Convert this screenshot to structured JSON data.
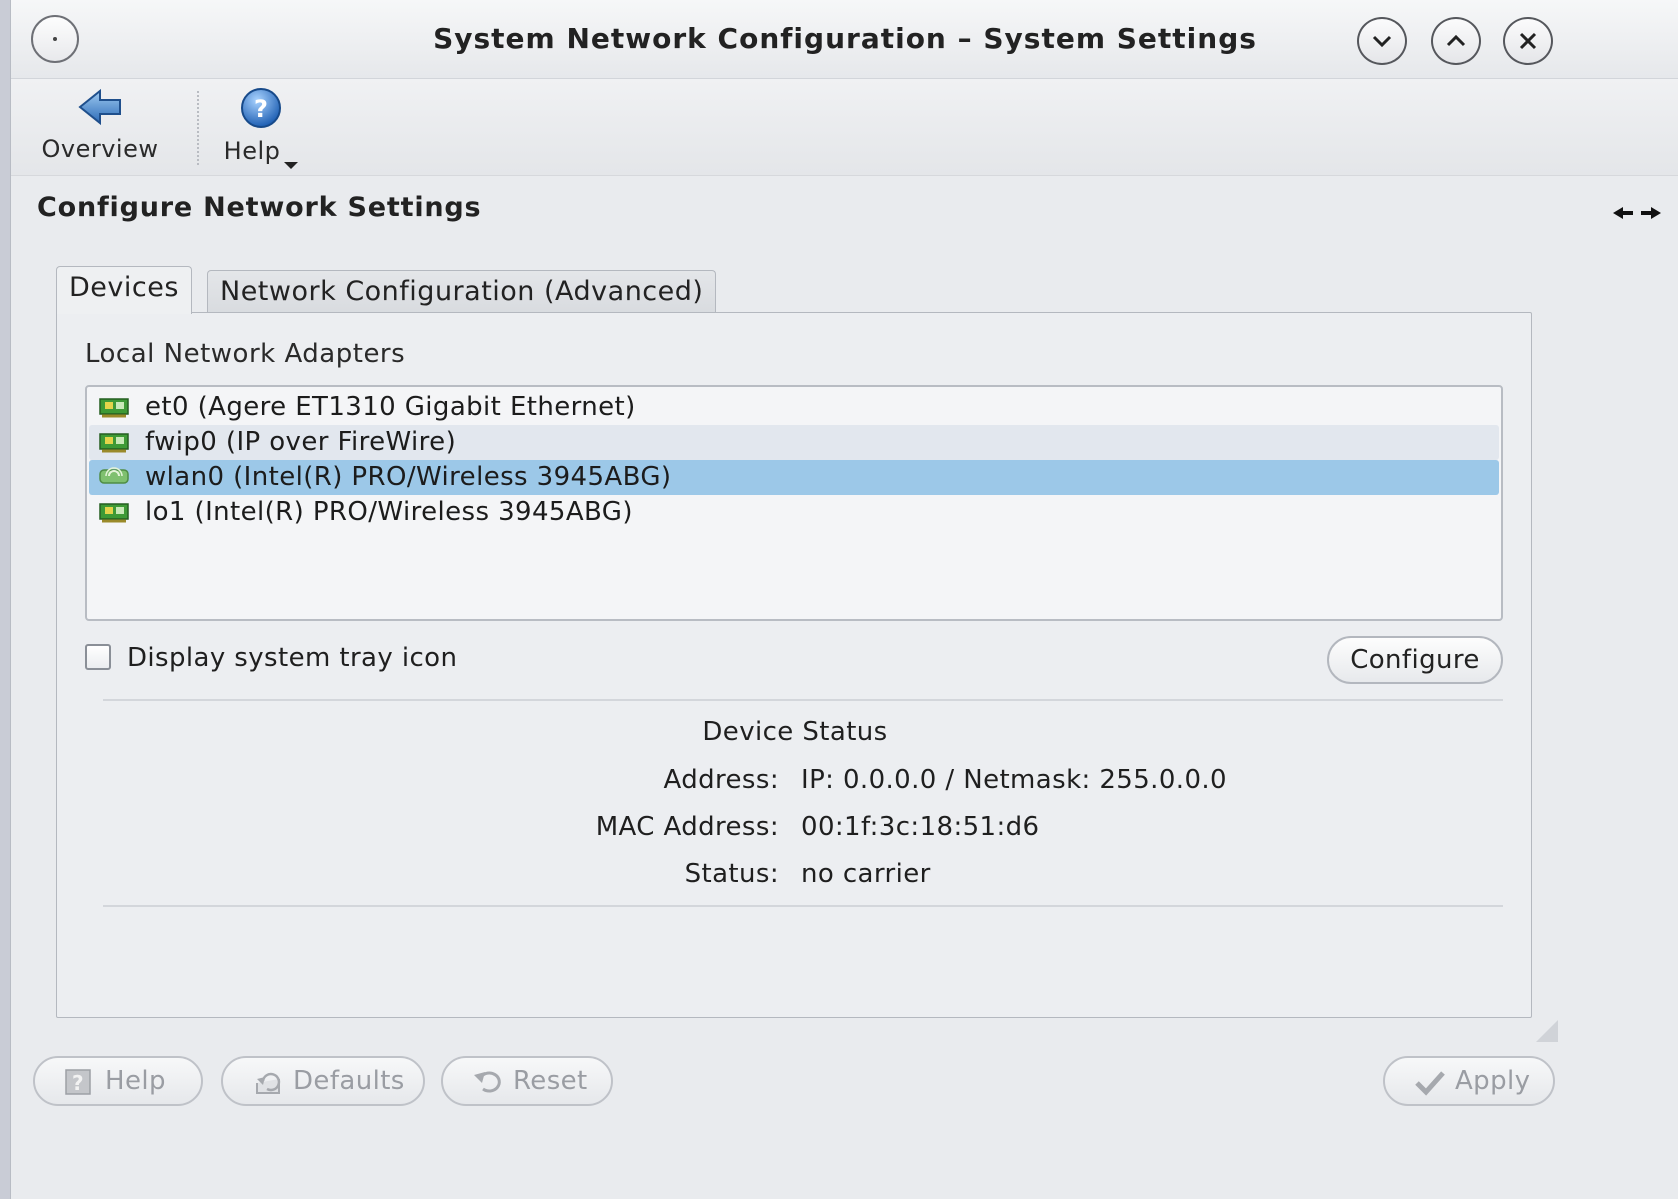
{
  "window": {
    "title": "System Network Configuration – System Settings",
    "buttons": [
      "minimize",
      "maximize",
      "close"
    ]
  },
  "toolbar": {
    "overview_label": "Overview",
    "help_label": "Help"
  },
  "header": {
    "title": "Configure Network Settings"
  },
  "tabs": [
    {
      "label": "Devices",
      "selected": true
    },
    {
      "label": "Network Configuration (Advanced)",
      "selected": false
    }
  ],
  "devices": {
    "section_label": "Local Network Adapters",
    "adapters": [
      {
        "label": "et0 (Agere ET1310 Gigabit Ethernet)",
        "selected": false
      },
      {
        "label": "fwip0 (IP over FireWire)",
        "selected": false
      },
      {
        "label": "wlan0 (Intel(R) PRO/Wireless 3945ABG)",
        "selected": true
      },
      {
        "label": "lo1 (Intel(R) PRO/Wireless 3945ABG)",
        "selected": false
      }
    ],
    "tray_checkbox_label": "Display system tray icon",
    "tray_checkbox_checked": false,
    "configure_label": "Configure"
  },
  "status": {
    "title": "Device Status",
    "rows": [
      {
        "key": "Address:",
        "value": "IP: 0.0.0.0 / Netmask: 255.0.0.0"
      },
      {
        "key": "MAC Address:",
        "value": "00:1f:3c:18:51:d6"
      },
      {
        "key": "Status:",
        "value": "no carrier"
      }
    ]
  },
  "footer": {
    "help_label": "Help",
    "defaults_label": "Defaults",
    "reset_label": "Reset",
    "apply_label": "Apply"
  },
  "colors": {
    "selection": "#9cc8e8",
    "window_bg": "#e9ebee"
  }
}
